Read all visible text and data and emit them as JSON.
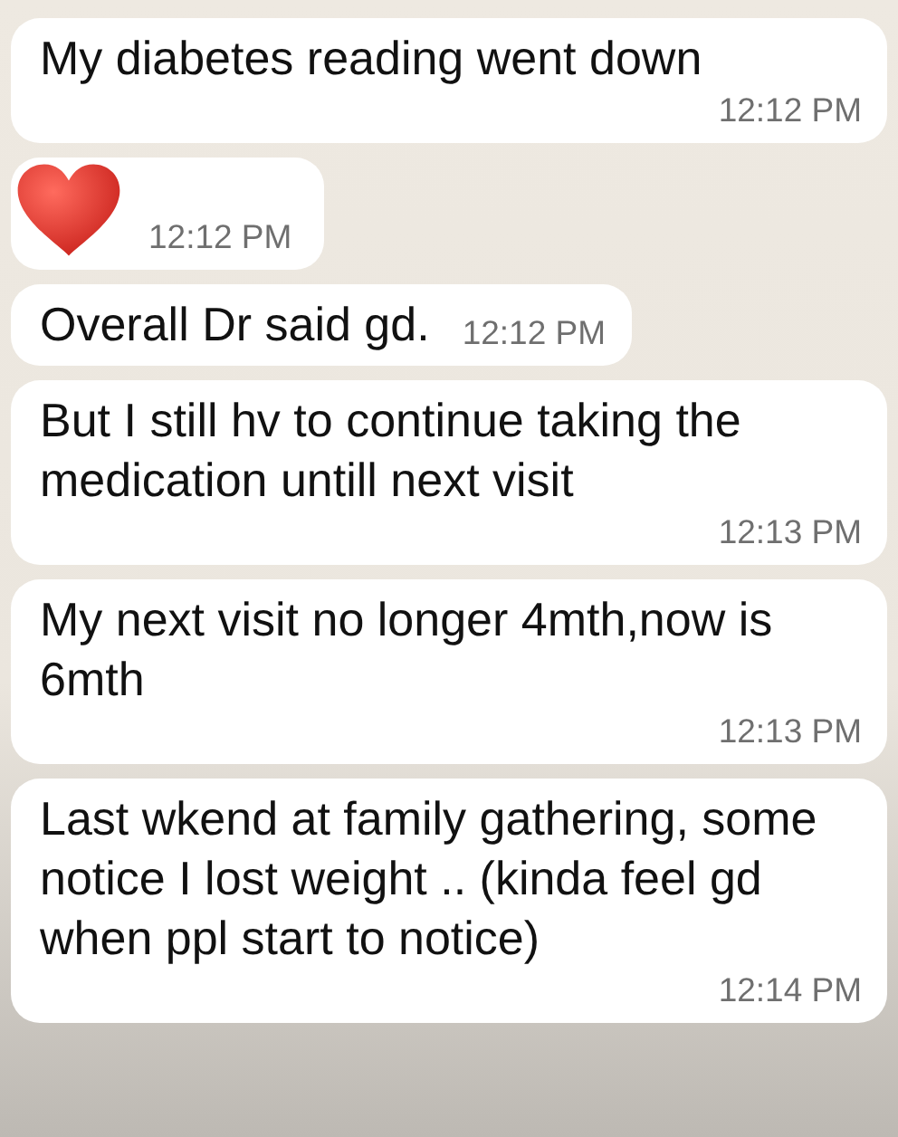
{
  "messages": [
    {
      "kind": "text",
      "text": "My diabetes reading went down",
      "time": "12:12 PM"
    },
    {
      "kind": "heart",
      "time": "12:12 PM"
    },
    {
      "kind": "text",
      "text": "Overall Dr said gd.",
      "time": "12:12 PM"
    },
    {
      "kind": "text",
      "text": "But I still hv to continue taking the medication untill next visit",
      "time": "12:13 PM"
    },
    {
      "kind": "text",
      "text": "My next visit no longer 4mth,now is 6mth",
      "time": "12:13 PM"
    },
    {
      "kind": "text",
      "text": "Last wkend at family gathering, some notice I lost weight .. (kinda feel gd when ppl start to notice)",
      "time": "12:14 PM"
    }
  ]
}
